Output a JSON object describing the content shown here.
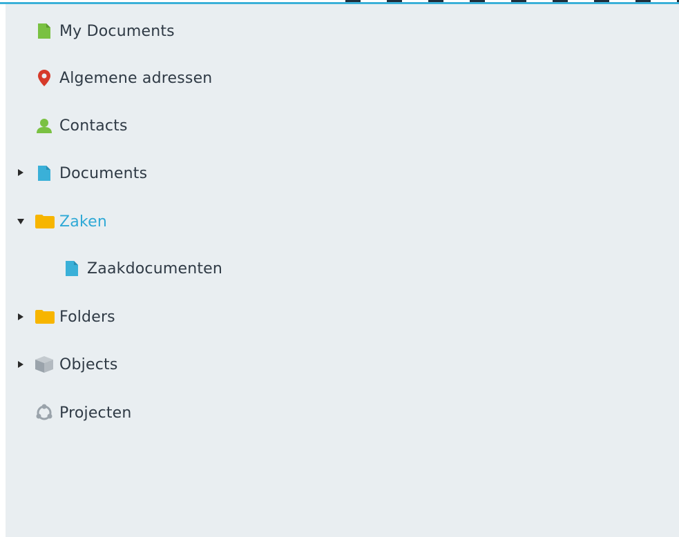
{
  "tree": {
    "items": [
      {
        "label": "My Documents",
        "icon": "document-icon",
        "icon_color": "#7ac142",
        "toggle": "none"
      },
      {
        "label": "Algemene adressen",
        "icon": "map-pin-icon",
        "icon_color": "#d63a2a",
        "toggle": "none"
      },
      {
        "label": "Contacts",
        "icon": "person-icon",
        "icon_color": "#7ac142",
        "toggle": "none"
      },
      {
        "label": "Documents",
        "icon": "document-icon",
        "icon_color": "#3ab0d8",
        "toggle": "collapsed"
      },
      {
        "label": "Zaken",
        "icon": "folder-icon",
        "icon_color": "#f7b500",
        "toggle": "expanded",
        "active": true
      },
      {
        "label": "Zaakdocumenten",
        "icon": "document-icon",
        "icon_color": "#3ab0d8",
        "toggle": "none",
        "child": true
      },
      {
        "label": "Folders",
        "icon": "folder-icon",
        "icon_color": "#f7b500",
        "toggle": "collapsed"
      },
      {
        "label": "Objects",
        "icon": "cube-icon",
        "icon_color": "#9aa3ab",
        "toggle": "collapsed"
      },
      {
        "label": "Projecten",
        "icon": "project-cycle-icon",
        "icon_color": "#9aa3ab",
        "toggle": "none"
      }
    ]
  },
  "colors": {
    "panel_bg": "#e9eef1",
    "text": "#2f3a45",
    "active_text": "#2fa9d6",
    "top_line": "#3ab0d8"
  }
}
